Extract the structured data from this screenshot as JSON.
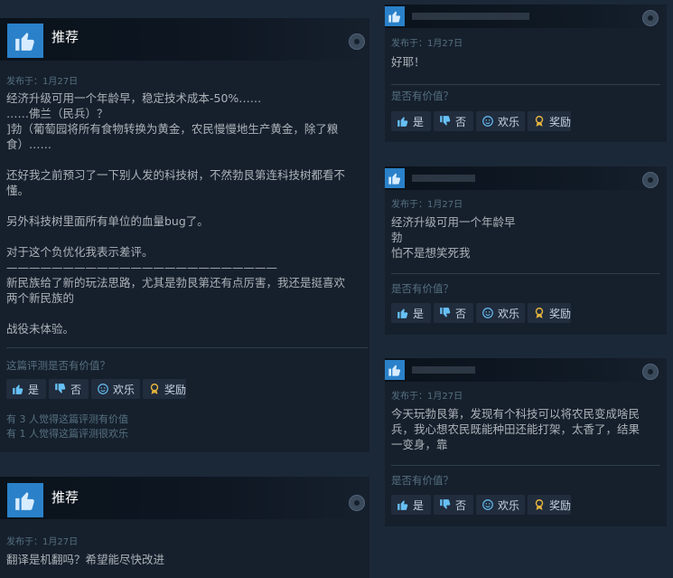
{
  "left": {
    "review1": {
      "title": "推荐",
      "date": "发布于：1月27日",
      "lines": [
        "经济升级可用一个年龄早，稳定技术成本-50%……",
        "……佛兰（民兵）？",
        "]勃（葡萄园将所有食物转换为黄金，农民慢慢地生产黄金，除了粮",
        "食）……",
        "",
        "还好我之前预习了一下别人发的科技树，不然勃艮第连科技树都看不",
        "懂。",
        "",
        "另外科技树里面所有单位的血量bug了。",
        "",
        "对于这个负优化我表示差评。",
        "————————————————————————",
        "新民族给了新的玩法思路，尤其是勃艮第还有点厉害，我还是挺喜欢",
        "两个新民族的",
        "",
        "战役未体验。"
      ],
      "helpful_question": "这篇评测是否有价值？",
      "buttons": {
        "yes": "是",
        "no": "否",
        "funny": "欢乐",
        "award": "奖励"
      },
      "stats": [
        "有 3 人觉得这篇评测有价值",
        "有 1 人觉得这篇评测很欢乐"
      ]
    },
    "review2": {
      "title": "推荐",
      "date": "发布于：1月27日",
      "text": "翻译是机翻吗？希望能尽快改进"
    }
  },
  "right": {
    "comments": [
      {
        "date": "发布于：1月27日",
        "text": "好耶！",
        "helpful_question": "是否有价值？",
        "buttons": {
          "yes": "是",
          "no": "否",
          "funny": "欢乐",
          "award": "奖励"
        }
      },
      {
        "date": "发布于：1月27日",
        "text": "经济升级可用一个年龄早\n勃\n怕不是想笑死我",
        "helpful_question": "是否有价值？",
        "buttons": {
          "yes": "是",
          "no": "否",
          "funny": "欢乐",
          "award": "奖励"
        }
      },
      {
        "date": "发布于：1月27日",
        "text": "今天玩勃艮第，发现有个科技可以将农民变成啥民\n兵，我心想农民既能种田还能打架，太香了，结果\n一变身，靠",
        "helpful_question": "是否有价值？",
        "buttons": {
          "yes": "是",
          "no": "否",
          "funny": "欢乐",
          "award": "奖励"
        }
      }
    ]
  },
  "colors": {
    "background": "#1b2838",
    "card": "#16202d",
    "accent": "#66c0f4",
    "thumb": "#2a81c9",
    "award": "#e4b43c"
  },
  "icons": {
    "recommend": "thumbs-up-icon",
    "steam": "steam-icon",
    "yes": "thumbs-up-icon",
    "no": "thumbs-down-icon",
    "funny": "smiley-icon",
    "award": "award-icon"
  }
}
